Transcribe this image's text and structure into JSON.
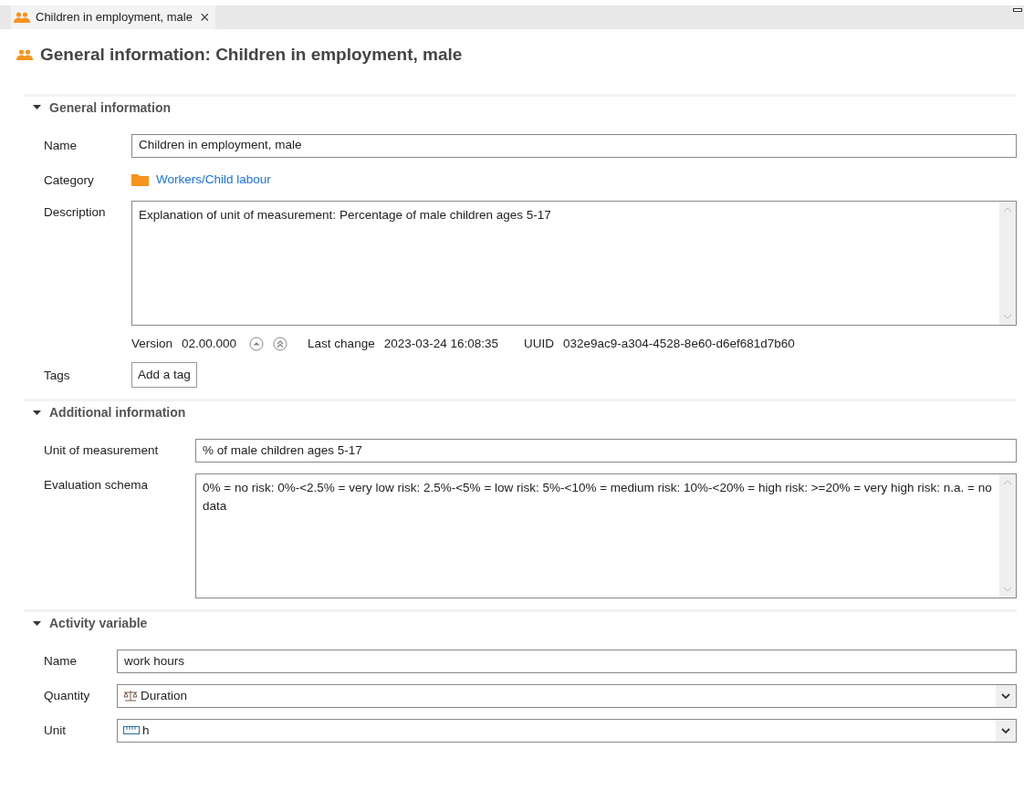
{
  "tab": {
    "label": "Children in employment, male",
    "selected": true,
    "close": "×"
  },
  "title": "General information: Children in employment, male",
  "sections": [
    {
      "title": "General information",
      "expanded": true,
      "rows": [
        {
          "kind": "text",
          "label": "Name",
          "value": "Children in employment, male"
        },
        {
          "kind": "link",
          "label": "Category",
          "value": "Workers/Child labour"
        },
        {
          "kind": "textarea",
          "label": "Description",
          "value": "Explanation of unit of measurement: Percentage of male children ages 5-17"
        },
        {
          "kind": "meta",
          "version_label": "Version",
          "version": "02.00.000",
          "change_label": "Last change",
          "change": "2023-03-24 16:08:35",
          "uuid_label": "UUID",
          "uuid": "032e9ac9-a304-4528-8e60-d6ef681d7b60"
        },
        {
          "kind": "tags",
          "label": "Tags",
          "button": "Add a tag"
        }
      ]
    },
    {
      "title": "Additional information",
      "expanded": true,
      "rows": [
        {
          "kind": "text",
          "label": "Unit of measurement",
          "value": "% of male children ages 5-17"
        },
        {
          "kind": "textarea",
          "label": "Evaluation schema",
          "value": "0% = no risk: 0%-<2.5% = very low risk: 2.5%-<5% = low risk: 5%-<10% = medium risk: 10%-<20% = high risk: >=20% = very high risk: n.a. = no data"
        }
      ]
    },
    {
      "title": "Activity variable",
      "expanded": true,
      "rows": [
        {
          "kind": "text",
          "label": "Name",
          "value": "work hours"
        },
        {
          "kind": "combo",
          "label": "Quantity",
          "value": "Duration"
        },
        {
          "kind": "combo",
          "label": "Unit",
          "value": "h"
        }
      ]
    }
  ]
}
